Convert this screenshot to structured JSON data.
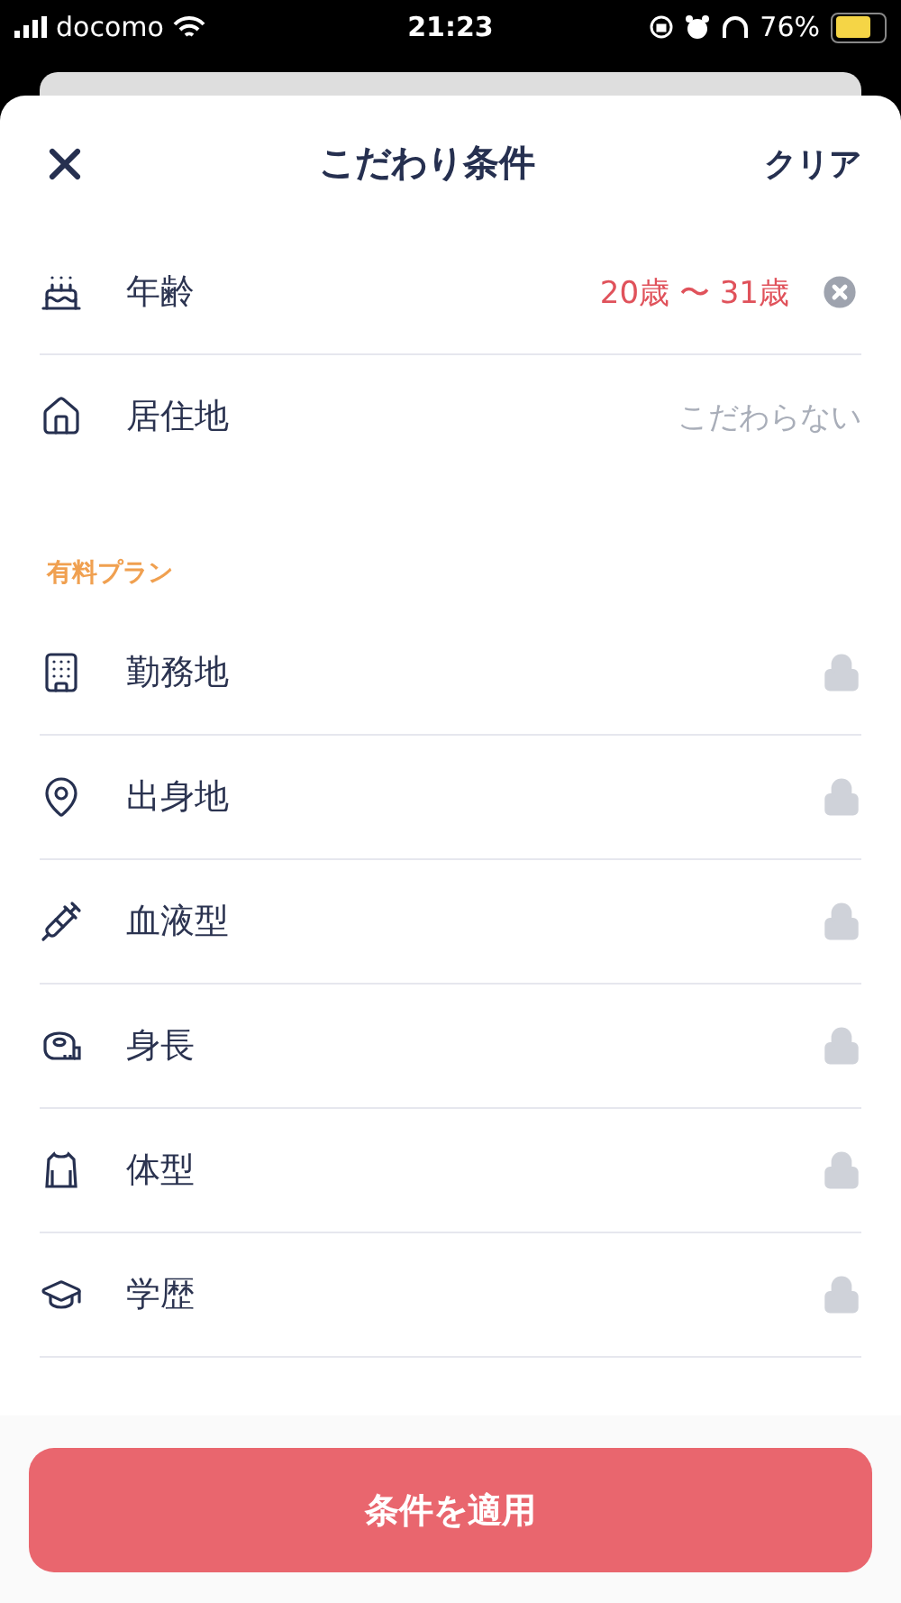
{
  "status_bar": {
    "carrier": "docomo",
    "time": "21:23",
    "battery": "76%"
  },
  "header": {
    "title": "こだわり条件",
    "clear": "クリア"
  },
  "filters": [
    {
      "label": "年齢",
      "value": "20歳 〜 31歳",
      "set": true
    },
    {
      "label": "居住地",
      "value": "こだわらない",
      "set": false
    }
  ],
  "paid_section": {
    "title": "有料プラン",
    "items": [
      {
        "label": "勤務地",
        "locked": true
      },
      {
        "label": "出身地",
        "locked": true
      },
      {
        "label": "血液型",
        "locked": true
      },
      {
        "label": "身長",
        "locked": true
      },
      {
        "label": "体型",
        "locked": true
      },
      {
        "label": "学歴",
        "locked": true
      }
    ]
  },
  "apply_button": "条件を適用"
}
